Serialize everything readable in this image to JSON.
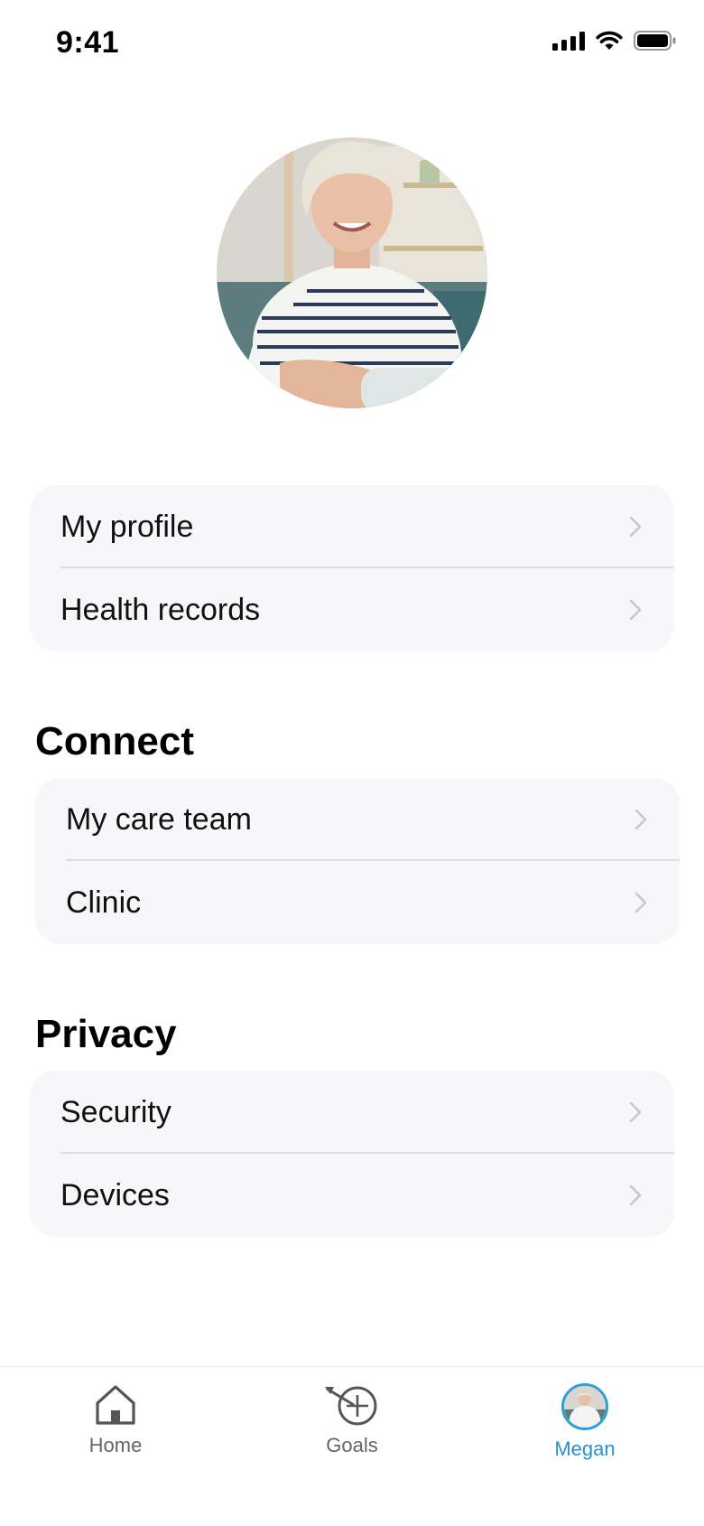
{
  "status_bar": {
    "time": "9:41"
  },
  "profile": {
    "avatar_icon": "user-photo"
  },
  "account_section": {
    "items": [
      {
        "label": "My profile"
      },
      {
        "label": "Health records"
      }
    ]
  },
  "connect_section": {
    "title": "Connect",
    "items": [
      {
        "label": "My care team"
      },
      {
        "label": "Clinic"
      }
    ]
  },
  "privacy_section": {
    "title": "Privacy",
    "items": [
      {
        "label": "Security"
      },
      {
        "label": "Devices"
      }
    ]
  },
  "tab_bar": {
    "tabs": [
      {
        "label": "Home",
        "icon": "house-icon"
      },
      {
        "label": "Goals",
        "icon": "target-icon"
      },
      {
        "label": "Megan",
        "icon": "avatar"
      }
    ],
    "active_tab": "Megan"
  },
  "colors": {
    "accent": "#2b8fd0",
    "card_background": "#f7f7f9",
    "divider": "#dcdce0",
    "chevron": "#c7c7cc"
  }
}
